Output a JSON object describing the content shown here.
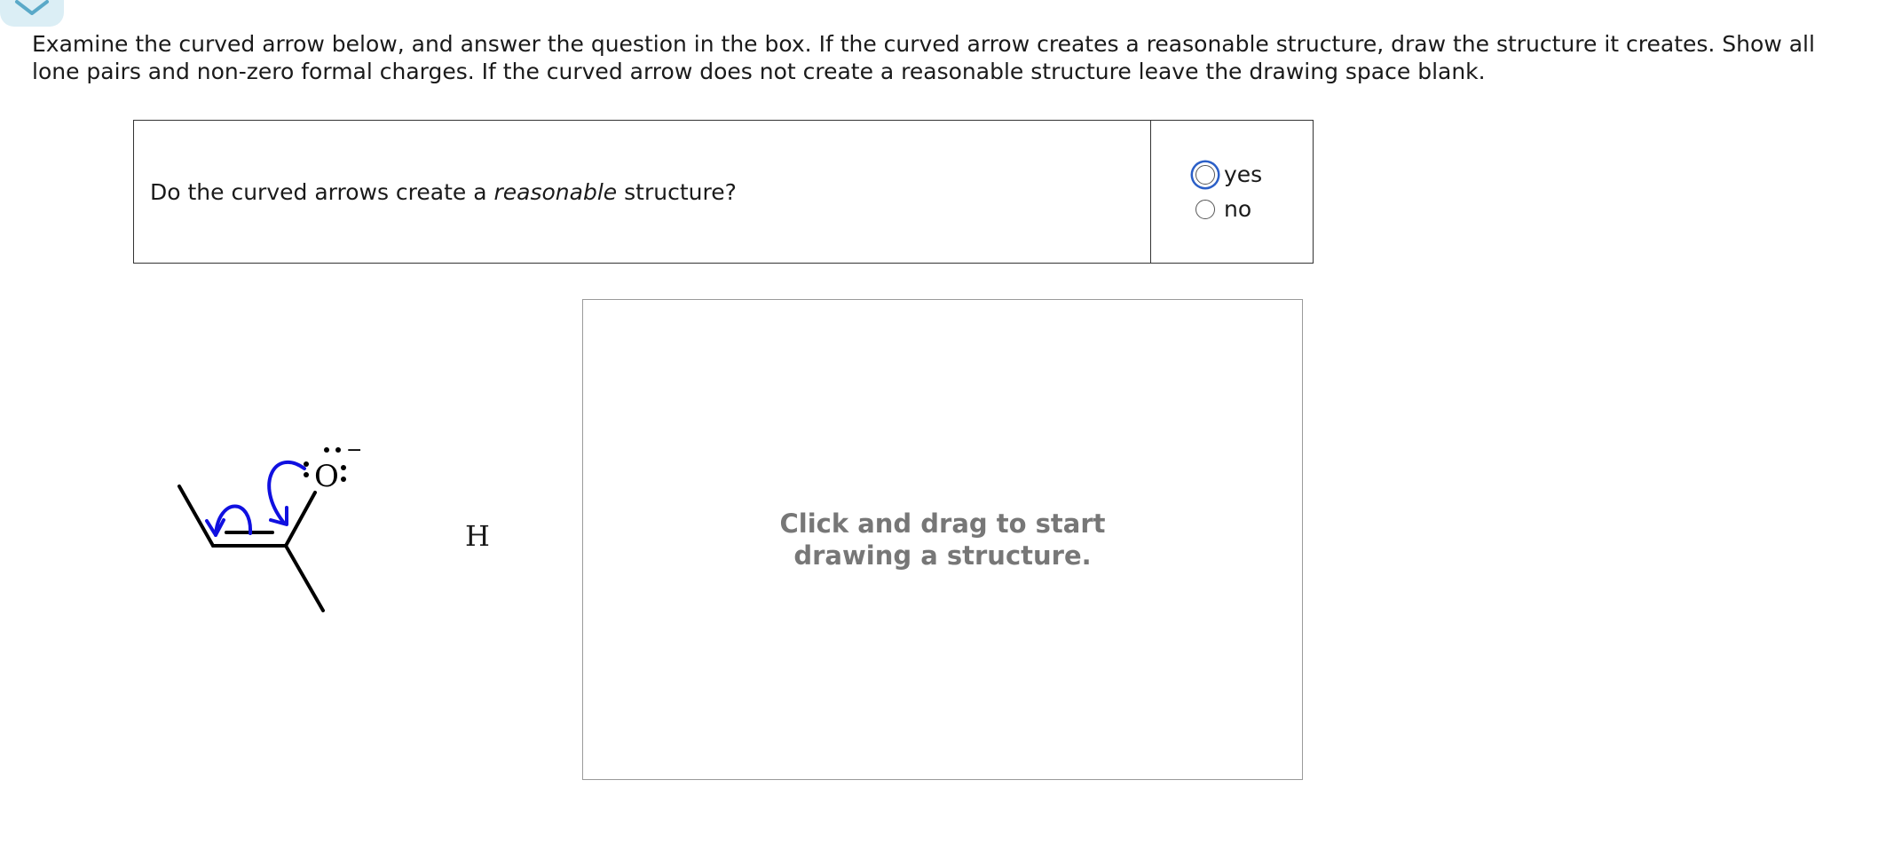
{
  "instructions": "Examine the curved arrow below, and answer the question in the box. If the curved arrow creates a reasonable structure, draw the structure it creates. Show all lone pairs and non-zero formal charges. If the curved arrow does not create a reasonable structure leave the drawing space blank.",
  "question": {
    "prefix": "Do the curved arrows create a ",
    "emphasis": "reasonable",
    "suffix": " structure?"
  },
  "options": [
    {
      "label": "yes"
    },
    {
      "label": "no"
    }
  ],
  "molecule": {
    "oxygen_label": "O",
    "charge": "−",
    "hydrogen_label": "H",
    "arrow_color": "#1010e0"
  },
  "drawing_area": {
    "hint": "Click and drag to start\ndrawing a structure."
  },
  "colors": {
    "focus_ring": "#2b5fc7",
    "tab_background": "#dbeef5",
    "tab_chevron": "#5aa9c8"
  }
}
